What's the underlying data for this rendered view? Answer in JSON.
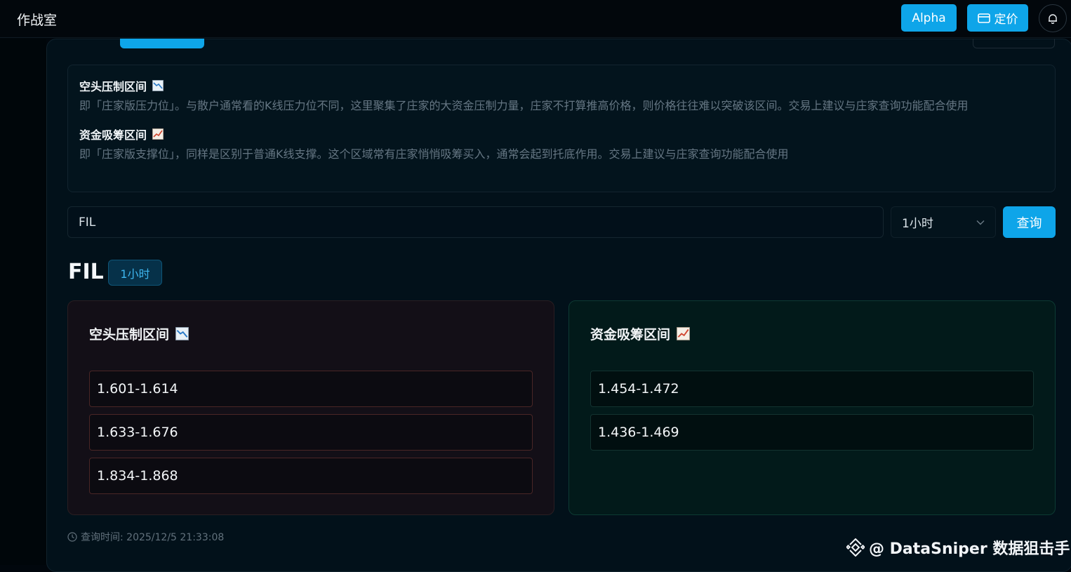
{
  "header": {
    "app_title": "作战室",
    "alpha_label": "Alpha",
    "pricing_label": "定价"
  },
  "info": {
    "resistance_title": "空头压制区间",
    "resistance_desc": "即「庄家版压力位」。与散户通常看的K线压力位不同，这里聚集了庄家的大资金压制力量，庄家不打算推高价格，则价格往往难以突破该区间。交易上建议与庄家查询功能配合使用",
    "support_title": "资金吸筹区间",
    "support_desc": "即「庄家版支撑位」，同样是区别于普通K线支撑。这个区域常有庄家悄悄吸筹买入，通常会起到托底作用。交易上建议与庄家查询功能配合使用"
  },
  "search": {
    "value": "FIL",
    "interval_selected": "1小时",
    "query_label": "查询"
  },
  "result": {
    "symbol": "FIL",
    "interval": "1小时",
    "short_title": "空头压制区间",
    "short_zones": [
      "1.601-1.614",
      "1.633-1.676",
      "1.834-1.868"
    ],
    "long_title": "资金吸筹区间",
    "long_zones": [
      "1.454-1.472",
      "1.436-1.469"
    ],
    "query_time": "查询时间: 2025/12/5 21:33:08"
  },
  "watermark": {
    "text": "@ DataSniper 数据狙击手"
  },
  "colors": {
    "accent": "#0ea5e9",
    "short_border": "#4a2626",
    "long_border": "#133330"
  },
  "icons": {
    "down_trend": "chart-decreasing-icon",
    "up_trend": "chart-increasing-icon",
    "pricing": "card-icon",
    "bell": "bell-icon",
    "clock": "clock-icon",
    "binance": "binance-logo-icon"
  }
}
